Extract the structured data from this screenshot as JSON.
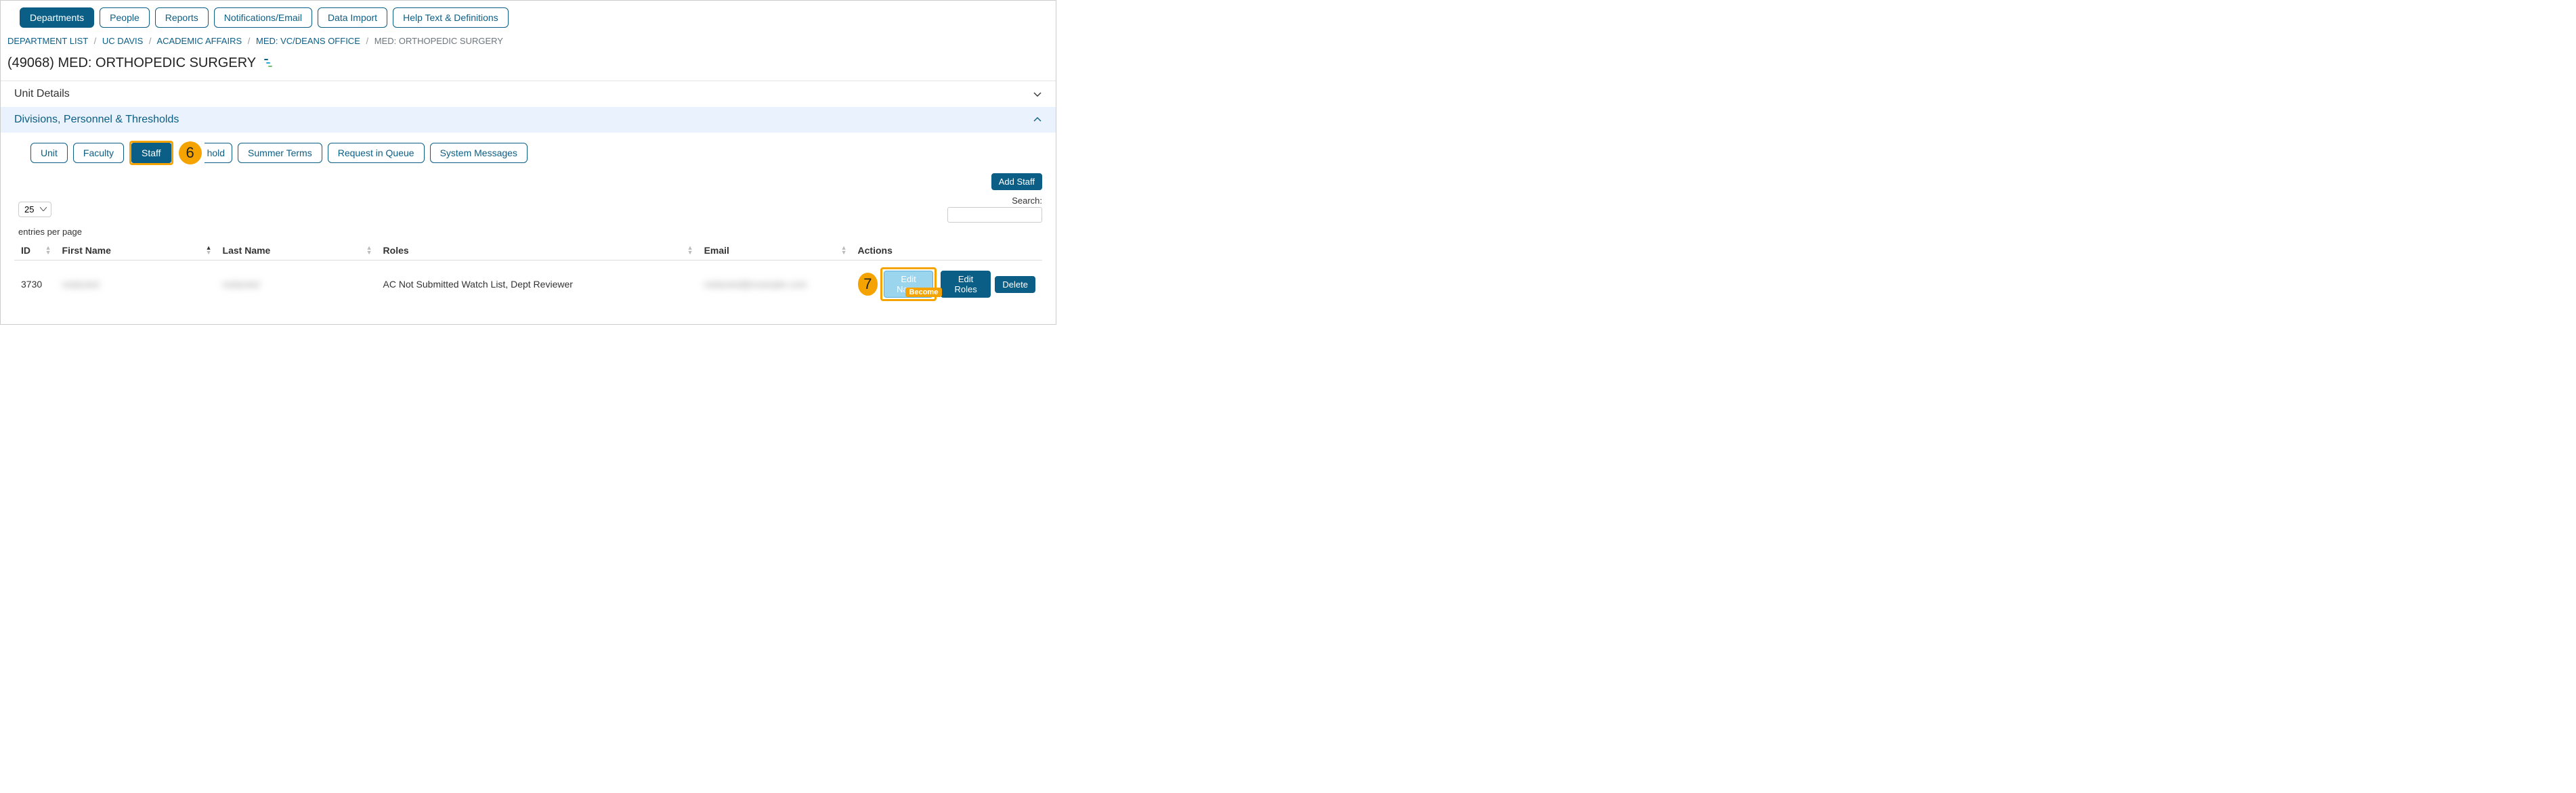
{
  "topnav": {
    "departments": "Departments",
    "people": "People",
    "reports": "Reports",
    "notifications": "Notifications/Email",
    "data_import": "Data Import",
    "help": "Help Text & Definitions"
  },
  "breadcrumb": {
    "items": [
      {
        "label": "DEPARTMENT LIST",
        "link": true
      },
      {
        "label": "UC DAVIS",
        "link": true
      },
      {
        "label": "ACADEMIC AFFAIRS",
        "link": true
      },
      {
        "label": "MED: VC/DEANS OFFICE",
        "link": true
      },
      {
        "label": "MED: ORTHOPEDIC SURGERY",
        "link": false
      }
    ]
  },
  "page_title": "(49068) MED: ORTHOPEDIC SURGERY",
  "sections": {
    "unit_details": "Unit Details",
    "divisions": "Divisions, Personnel & Thresholds"
  },
  "subtabs": {
    "unit": "Unit",
    "faculty": "Faculty",
    "staff": "Staff",
    "threshold_partial": "hold",
    "summer": "Summer Terms",
    "queue": "Request in Queue",
    "system": "System Messages"
  },
  "steps": {
    "s6": "6",
    "s7": "7"
  },
  "buttons": {
    "add_staff": "Add Staff",
    "edit_name": "Edit Name",
    "edit_roles": "Edit Roles",
    "delete": "Delete",
    "become": "Become"
  },
  "paging": {
    "select_value": "25",
    "label": "entries per page"
  },
  "search": {
    "label": "Search:",
    "value": ""
  },
  "table": {
    "headers": {
      "id": "ID",
      "first_name": "First Name",
      "last_name": "Last Name",
      "roles": "Roles",
      "email": "Email",
      "actions": "Actions"
    },
    "rows": [
      {
        "id": "3730",
        "first_name": "redacted",
        "last_name": "redacted",
        "roles": "AC Not Submitted Watch List, Dept Reviewer",
        "email": "redacted@example.com"
      }
    ]
  }
}
